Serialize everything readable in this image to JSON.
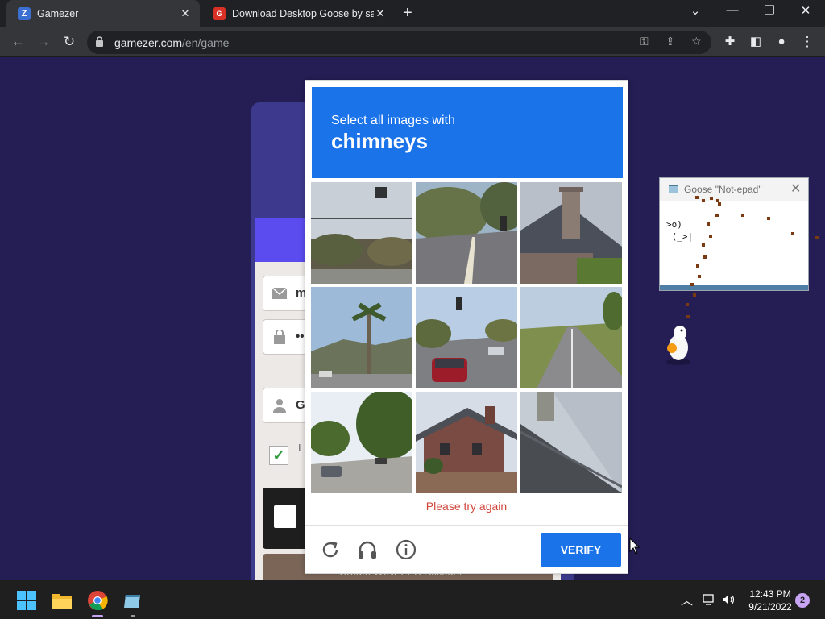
{
  "browser": {
    "tabs": [
      {
        "label": "Gamezer",
        "favicon": "Z"
      },
      {
        "label": "Download Desktop Goose by san",
        "favicon": "G"
      }
    ],
    "address": {
      "host": "gamezer.com",
      "path": "/en/game"
    }
  },
  "gamezer_form": {
    "email_value": "m",
    "password_value": "••",
    "gender_value": "G",
    "checkbox_label": "I",
    "create_button_label": "Create WINEZER Account"
  },
  "captcha": {
    "prompt_line1": "Select all images with",
    "prompt_target": "chimneys",
    "error_message": "Please try again",
    "verify_label": "VERIFY",
    "tiles": [
      "street-traffic-light",
      "road-curve",
      "house-with-chimney",
      "palm-tree-street",
      "street-red-car",
      "highway",
      "trees-street",
      "brick-house",
      "house-roof"
    ]
  },
  "notepad": {
    "title": "Goose \"Not-epad\"",
    "text": ">o)\n (_>|"
  },
  "taskbar": {
    "time": "12:43 PM",
    "date": "9/21/2022",
    "notification_count": "2"
  },
  "colors": {
    "accent_blue": "#1a73e8",
    "page_bg": "#241e55",
    "error": "#d0453a"
  }
}
